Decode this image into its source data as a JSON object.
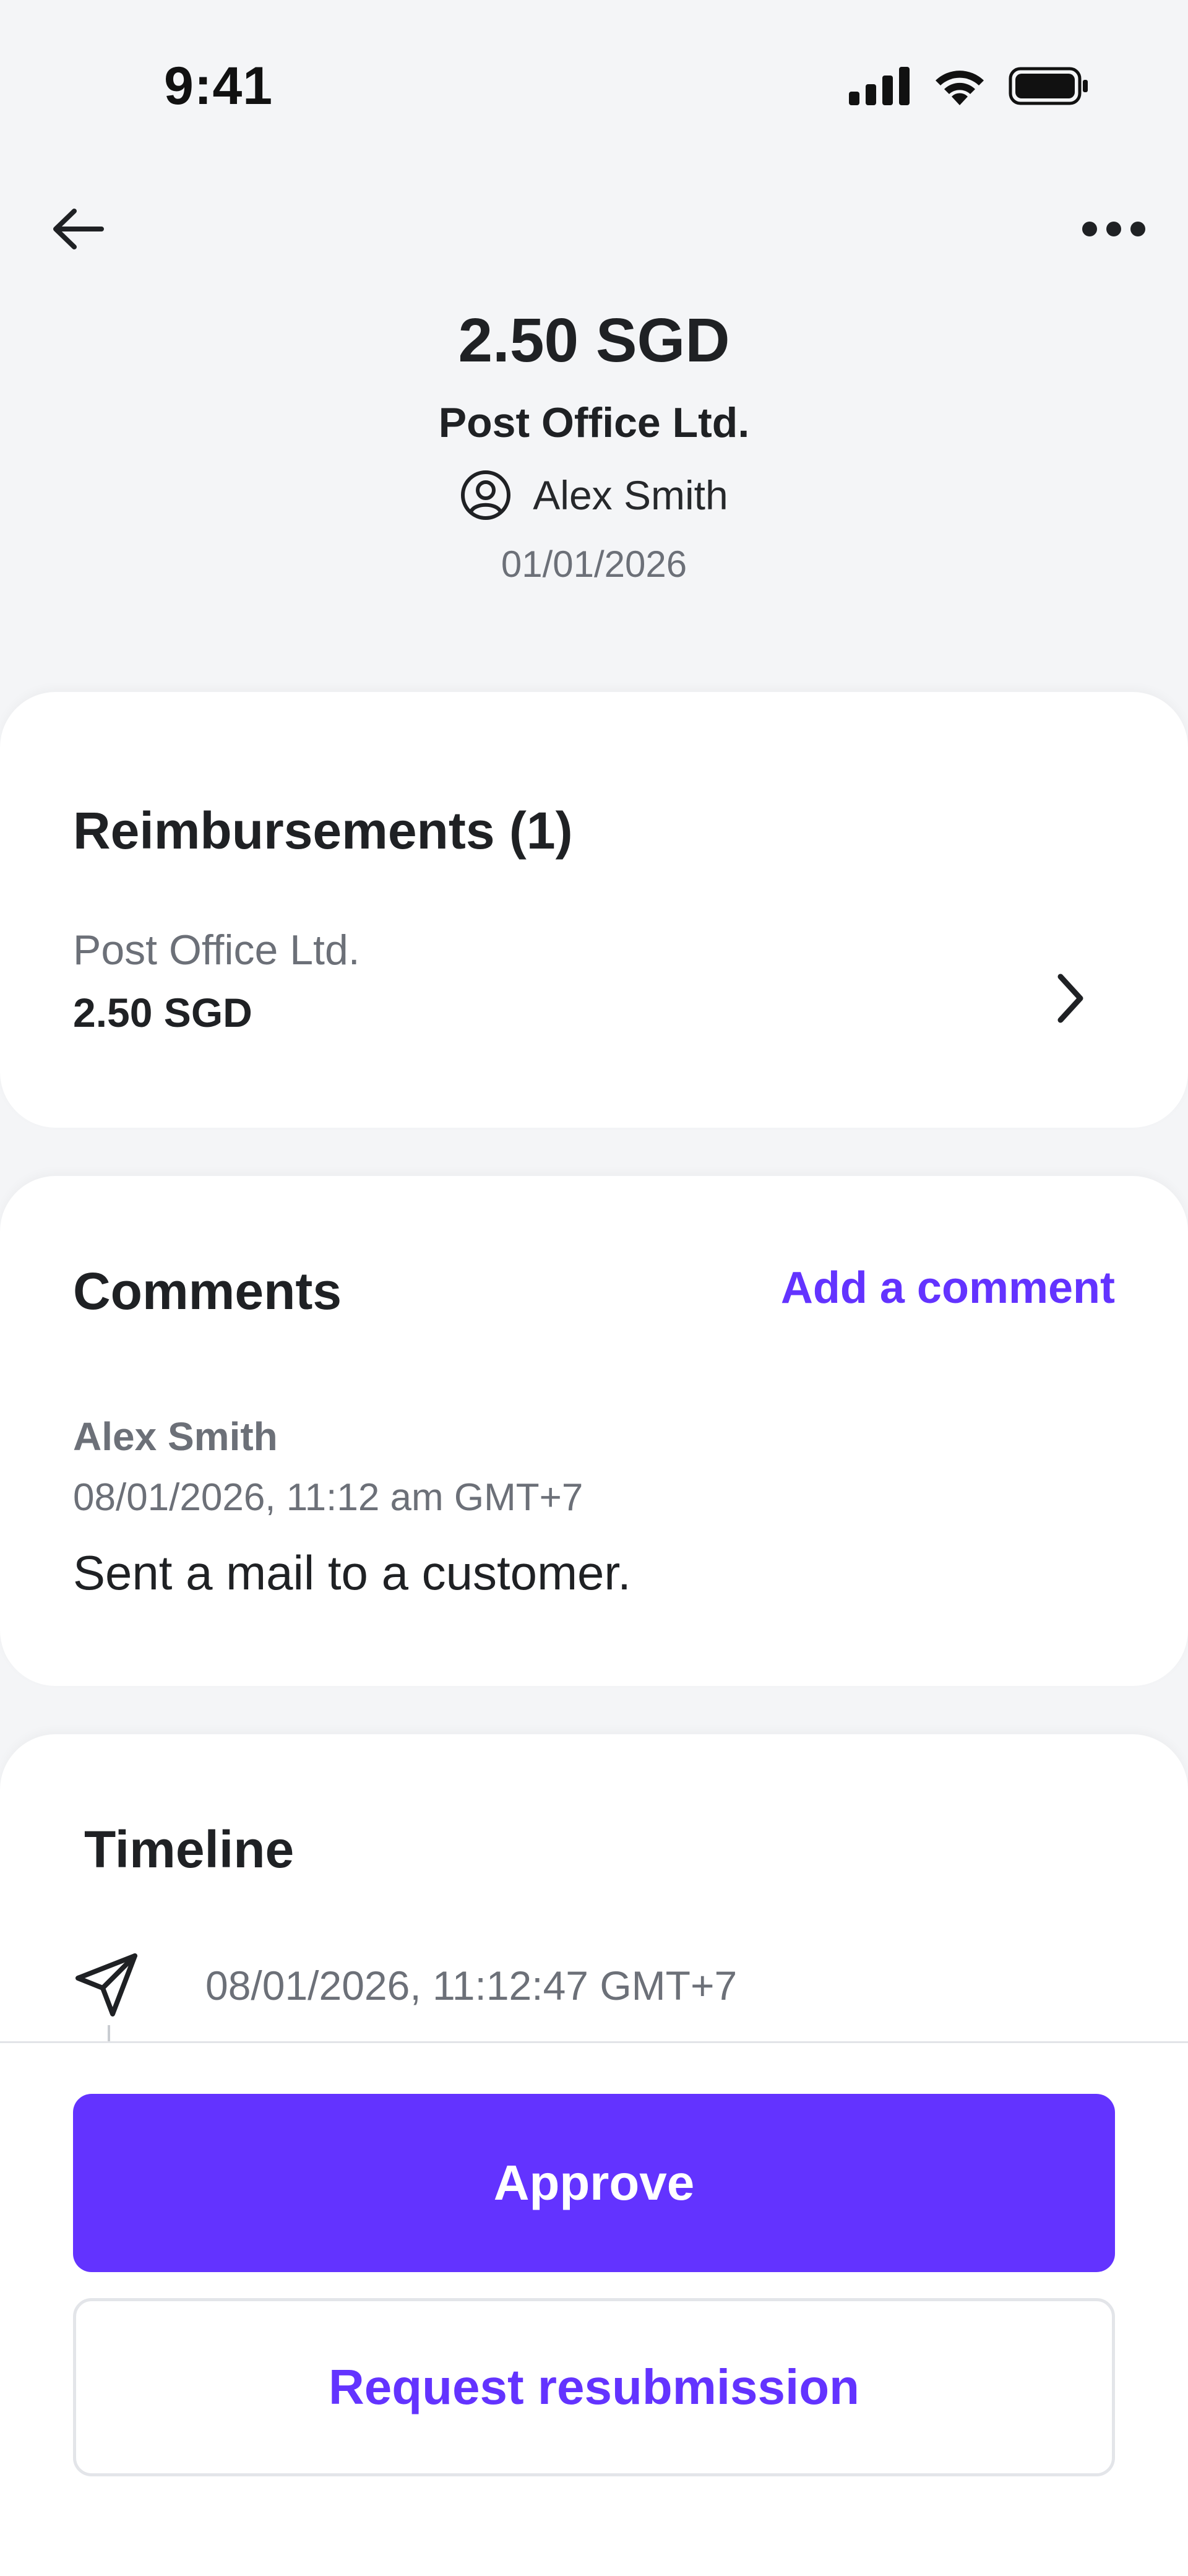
{
  "status_bar": {
    "time": "9:41",
    "icons": [
      "cellular-signal-icon",
      "wifi-icon",
      "battery-icon"
    ]
  },
  "nav": {
    "back_icon": "arrow-left-icon",
    "more_icon": "more-horizontal-icon"
  },
  "header": {
    "amount": "2.50 SGD",
    "merchant": "Post Office Ltd.",
    "user_icon": "user-circle-icon",
    "user_name": "Alex Smith",
    "date": "01/01/2026"
  },
  "reimbursements": {
    "title": "Reimbursements (1)",
    "items": [
      {
        "merchant": "Post Office Ltd.",
        "amount": "2.50 SGD",
        "icon": "chevron-right-icon"
      }
    ]
  },
  "comments": {
    "title": "Comments",
    "add_label": "Add a comment",
    "items": [
      {
        "author": "Alex Smith",
        "timestamp": "08/01/2026, 11:12 am GMT+7",
        "text": "Sent a mail to a customer."
      }
    ]
  },
  "timeline": {
    "title": "Timeline",
    "items": [
      {
        "icon": "paper-plane-icon",
        "timestamp": "08/01/2026, 11:12:47 GMT+7"
      }
    ]
  },
  "actions": {
    "approve_label": "Approve",
    "resubmit_label": "Request resubmission"
  },
  "colors": {
    "accent": "#6333ff",
    "background": "#f4f5f7",
    "text_primary": "#1f2124",
    "text_secondary": "#6c7078"
  }
}
